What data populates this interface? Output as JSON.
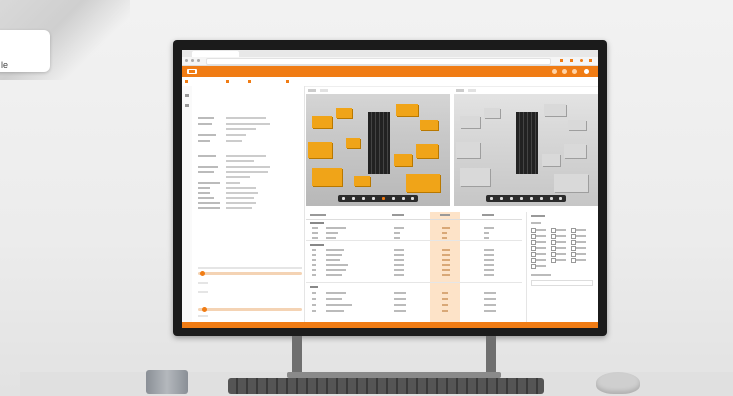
{
  "corner": {
    "text": "le"
  },
  "browser": {
    "tab_title": "",
    "url": ""
  },
  "app": {
    "title": "",
    "menu": [
      "",
      "",
      "",
      ""
    ]
  },
  "sidebar": {
    "section_weights": "",
    "section_sliders": ""
  },
  "colors": {
    "accent": "#f07c14",
    "highlight": "#fde3c8",
    "building_color": "#f0a418",
    "building_gray": "#d9d9d9"
  },
  "icons": [
    "back-icon",
    "forward-icon",
    "reload-icon",
    "logo-icon",
    "menu-icon",
    "cube-icon",
    "layers-icon",
    "settings-icon"
  ]
}
